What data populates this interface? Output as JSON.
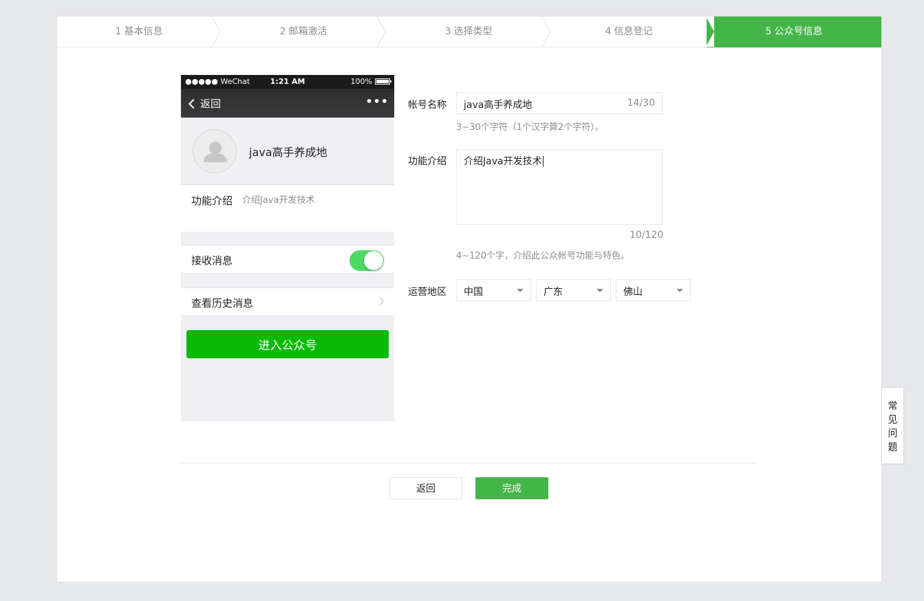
{
  "steps": [
    {
      "num": "1",
      "label": "基本信息"
    },
    {
      "num": "2",
      "label": "邮箱激活"
    },
    {
      "num": "3",
      "label": "选择类型"
    },
    {
      "num": "4",
      "label": "信息登记"
    },
    {
      "num": "5",
      "label": "公众号信息"
    }
  ],
  "active_step": "5",
  "phone": {
    "status": {
      "carrier": "●●●●● WeChat",
      "time": "1:21 AM",
      "battery": "100%"
    },
    "nav": {
      "back": "返回",
      "more": "•••"
    },
    "account_name": "java高手养成地",
    "intro_label": "功能介绍",
    "intro_value": "介绍Java开发技术",
    "receive_label": "接收消息",
    "receive_enabled": true,
    "history_label": "查看历史消息",
    "enter_button": "进入公众号"
  },
  "form": {
    "name_label": "帐号名称",
    "name_value": "java高手养成地",
    "name_count": "14/30",
    "name_hint": "3~30个字符（1个汉字算2个字符）。",
    "intro_label": "功能介绍",
    "intro_value": "介绍Java开发技术",
    "intro_count": "10/120",
    "intro_hint": "4~120个字，介绍此公众帐号功能与特色。",
    "region_label": "运营地区",
    "country": "中国",
    "province": "广东",
    "city": "佛山"
  },
  "buttons": {
    "back": "返回",
    "done": "完成"
  },
  "faq": [
    "常",
    "见",
    "问",
    "题"
  ],
  "colors": {
    "accent": "#44b549",
    "wechat_green": "#09bb07",
    "toggle_on": "#4cd964"
  }
}
